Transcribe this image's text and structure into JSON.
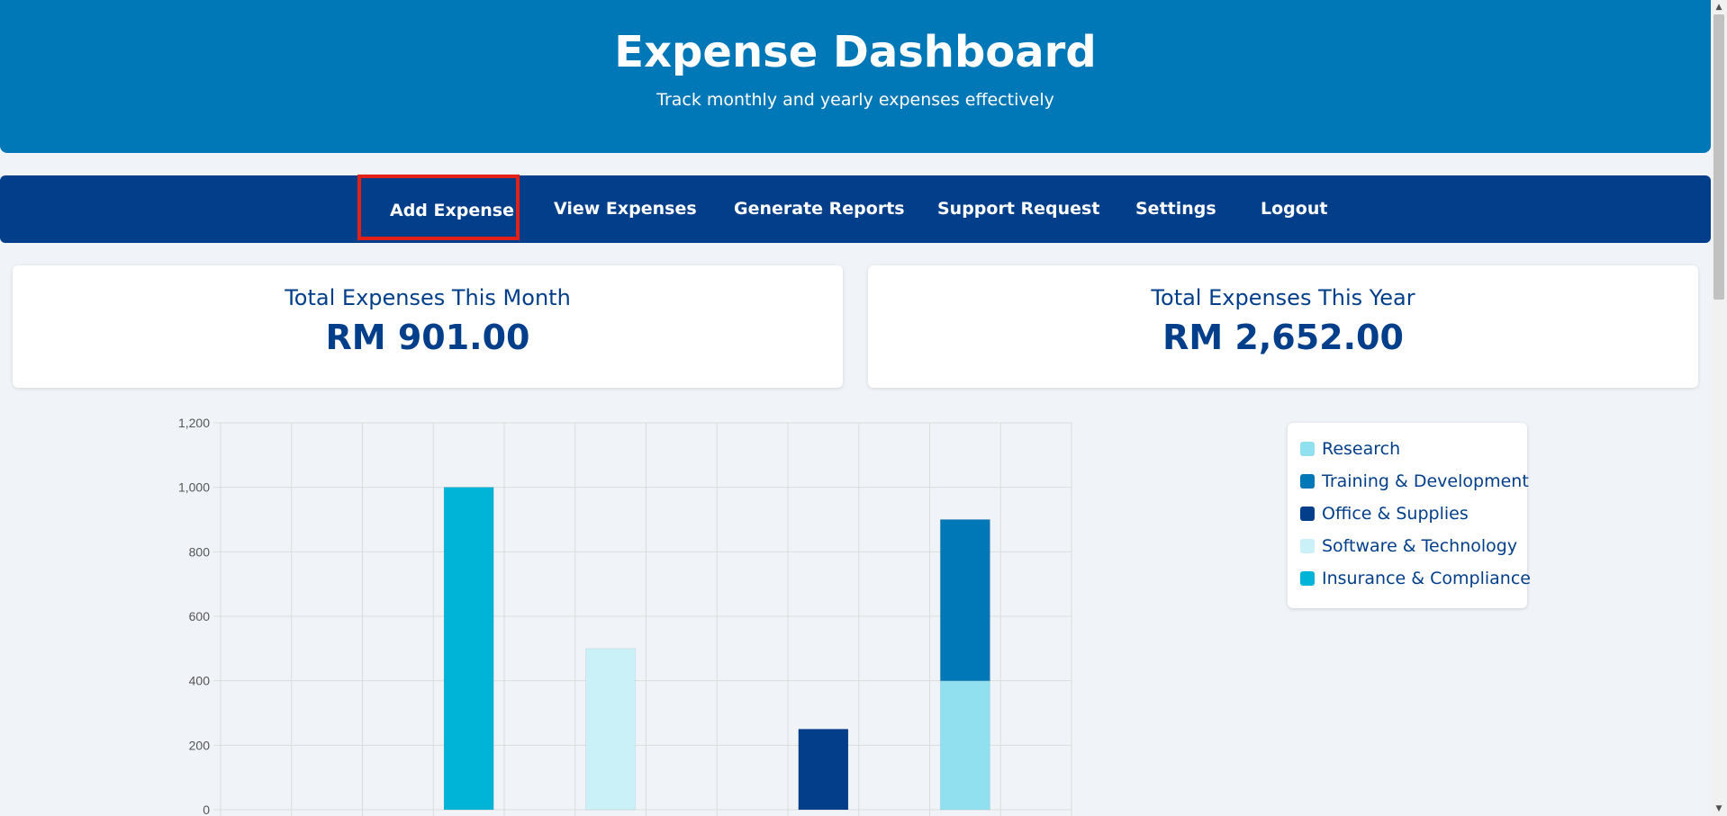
{
  "header": {
    "title": "Expense Dashboard",
    "subtitle": "Track monthly and yearly expenses effectively"
  },
  "nav": {
    "items": [
      {
        "label": "Add Expense"
      },
      {
        "label": "View Expenses"
      },
      {
        "label": "Generate Reports"
      },
      {
        "label": "Support Request"
      },
      {
        "label": "Settings"
      },
      {
        "label": "Logout"
      }
    ]
  },
  "cards": {
    "month": {
      "title": "Total Expenses This Month",
      "value": "RM 901.00"
    },
    "year": {
      "title": "Total Expenses This Year",
      "value": "RM 2,652.00"
    }
  },
  "colors": {
    "header": "#0077b6",
    "nav": "#023e8a",
    "highlight_box": "#e32119",
    "background": "#f0f4f8"
  },
  "legend": {
    "items": [
      {
        "label": "Research",
        "color": "#90e0ef"
      },
      {
        "label": "Training & Development",
        "color": "#0077b6"
      },
      {
        "label": "Office & Supplies",
        "color": "#023e8a"
      },
      {
        "label": "Software & Technology",
        "color": "#caf0f8"
      },
      {
        "label": "Insurance & Compliance",
        "color": "#00b4d8"
      }
    ]
  },
  "chart_data": {
    "type": "bar",
    "stacked": true,
    "grid": true,
    "legend_position": "right",
    "ylim": [
      0,
      1200
    ],
    "yticks": [
      "0",
      "200",
      "400",
      "600",
      "800",
      "1,000",
      "1,200"
    ],
    "series": [
      {
        "name": "Research",
        "color": "#90e0ef",
        "values": [
          0,
          0,
          0,
          0,
          0,
          0,
          0,
          0,
          0,
          0,
          400,
          0
        ]
      },
      {
        "name": "Training & Development",
        "color": "#0077b6",
        "values": [
          0,
          0,
          0,
          0,
          0,
          0,
          0,
          0,
          0,
          0,
          500,
          0
        ]
      },
      {
        "name": "Office & Supplies",
        "color": "#023e8a",
        "values": [
          0,
          0,
          0,
          0,
          0,
          0,
          0,
          0,
          250,
          0,
          0,
          0
        ]
      },
      {
        "name": "Software & Technology",
        "color": "#caf0f8",
        "values": [
          0,
          0,
          0,
          0,
          0,
          500,
          0,
          0,
          0,
          0,
          0,
          0
        ]
      },
      {
        "name": "Insurance & Compliance",
        "color": "#00b4d8",
        "values": [
          0,
          0,
          0,
          1000,
          0,
          0,
          0,
          0,
          0,
          0,
          0,
          0
        ]
      }
    ]
  }
}
